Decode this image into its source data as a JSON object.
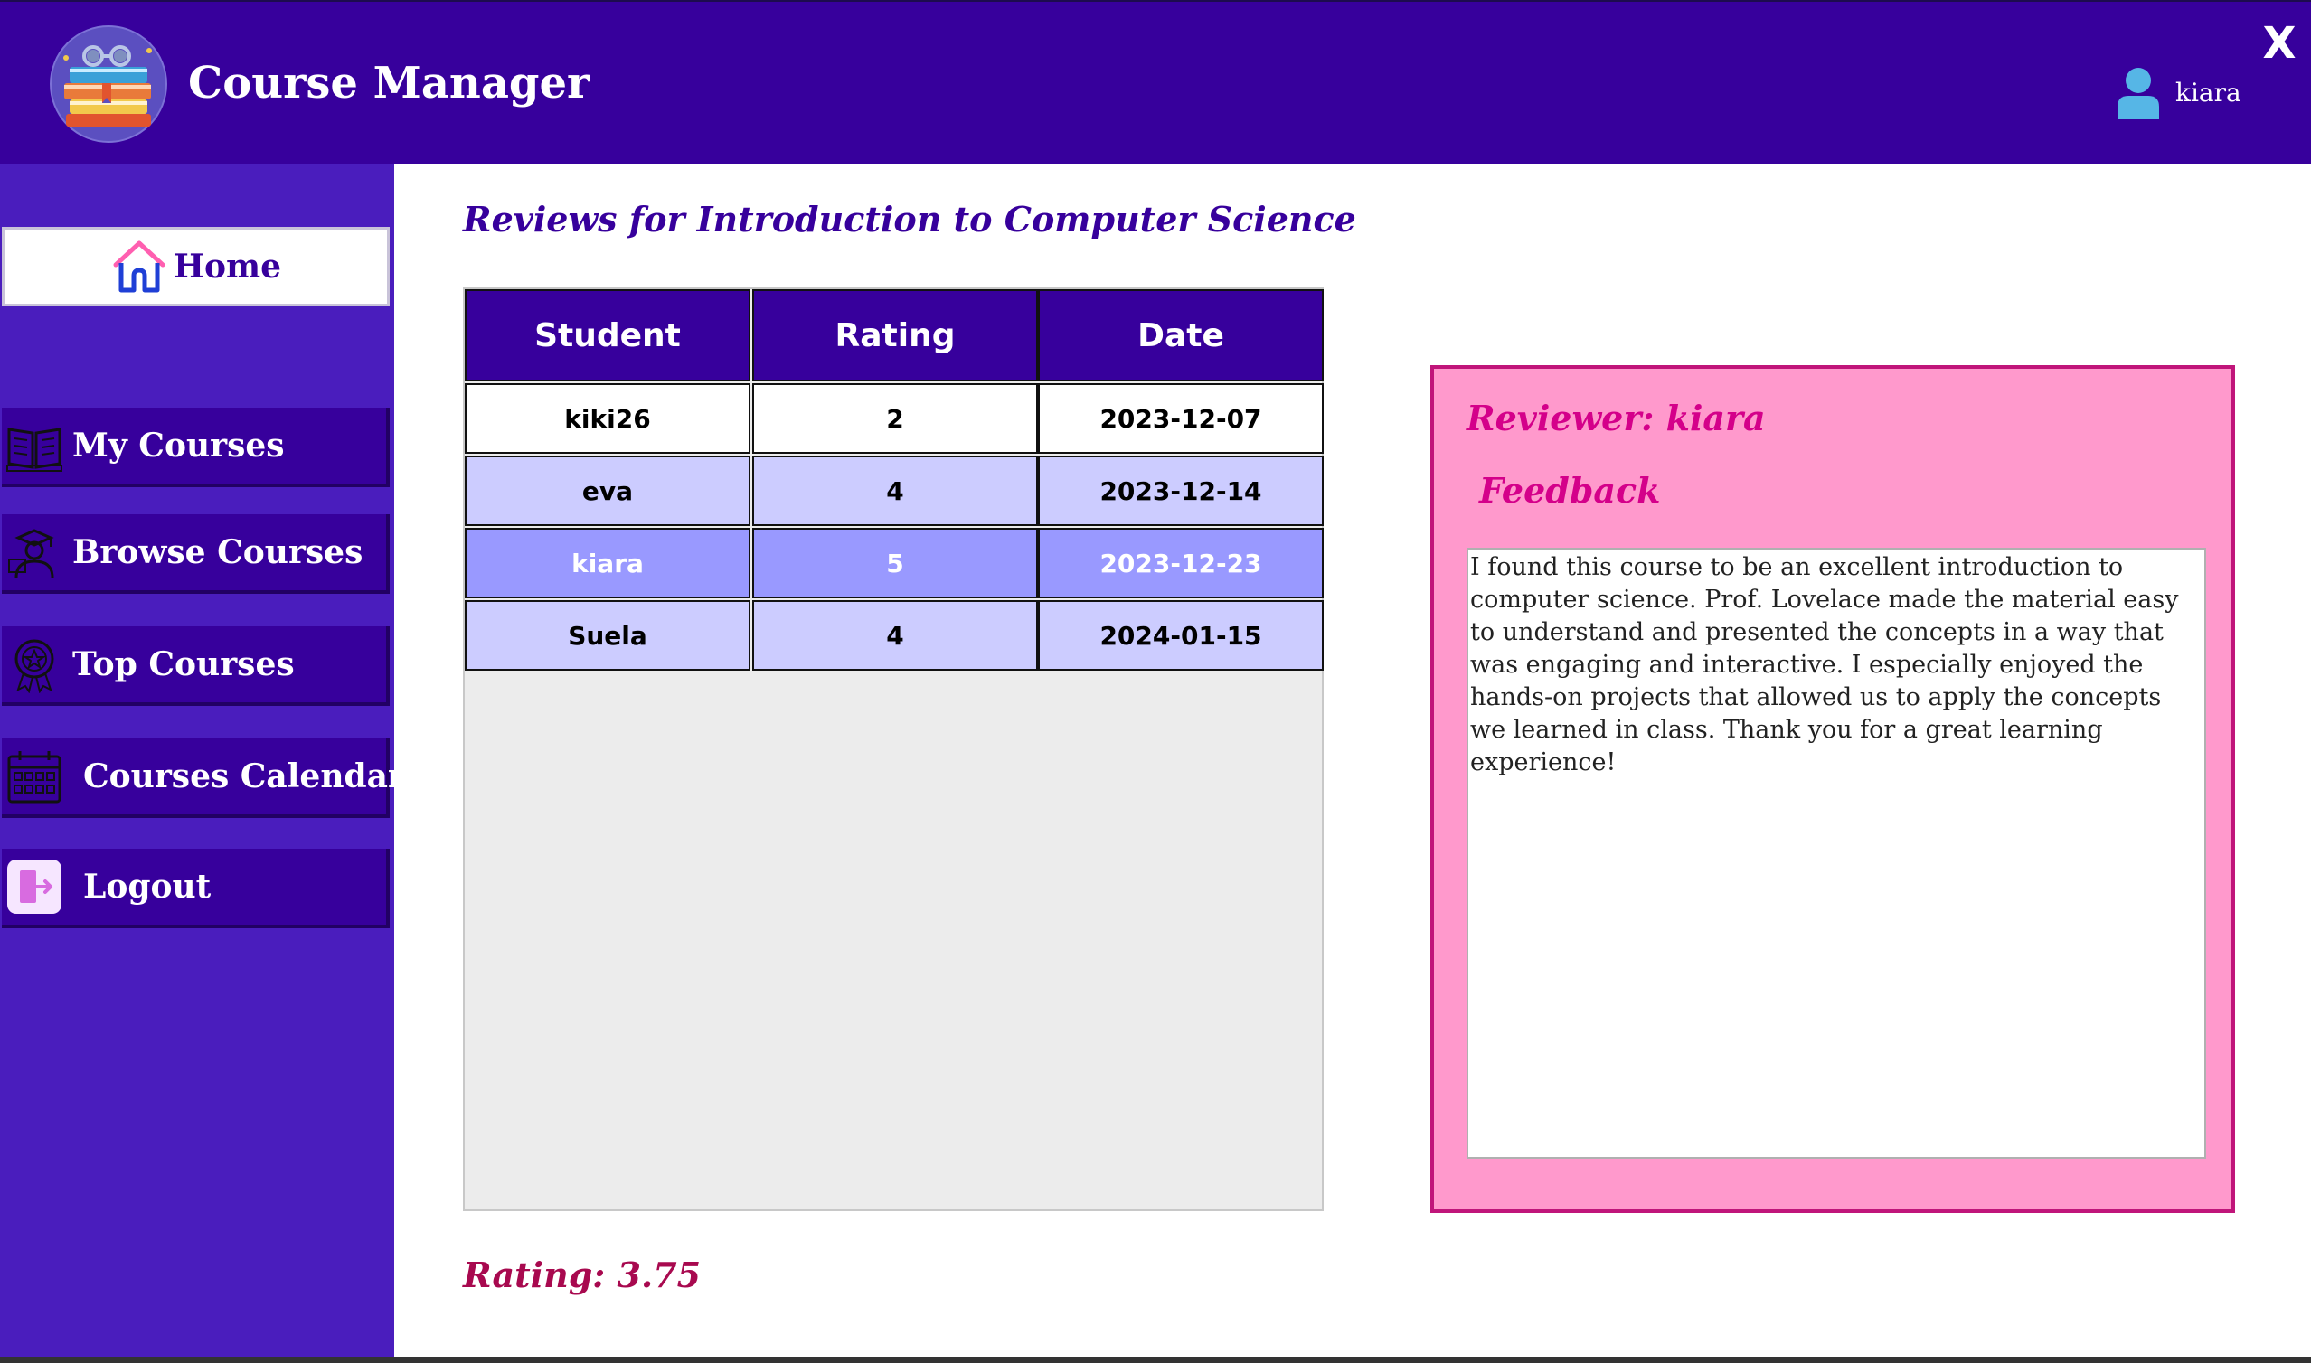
{
  "header": {
    "app_title": "Course Manager",
    "user_name": "kiara",
    "close_label": "X"
  },
  "sidebar": {
    "items": [
      {
        "label": "Home",
        "icon": "home-icon"
      },
      {
        "label": "My Courses",
        "icon": "book-icon"
      },
      {
        "label": "Browse Courses",
        "icon": "teacher-icon"
      },
      {
        "label": "Top Courses",
        "icon": "award-badge-icon"
      },
      {
        "label": "Courses Calendar",
        "icon": "calendar-icon"
      },
      {
        "label": "Logout",
        "icon": "logout-icon"
      }
    ]
  },
  "main": {
    "reviews_title": "Reviews for Introduction to Computer Science",
    "table": {
      "columns": [
        "Student",
        "Rating",
        "Date"
      ],
      "rows": [
        {
          "student": "kiki26",
          "rating": "2",
          "date": "2023-12-07",
          "state": "normal"
        },
        {
          "student": "eva",
          "rating": "4",
          "date": "2023-12-14",
          "state": "alternate"
        },
        {
          "student": "kiara",
          "rating": "5",
          "date": "2023-12-23",
          "state": "selected"
        },
        {
          "student": "Suela",
          "rating": "4",
          "date": "2024-01-15",
          "state": "alternate"
        }
      ]
    },
    "rating_summary": "Rating: 3.75"
  },
  "feedback": {
    "reviewer_label": "Reviewer: kiara",
    "feedback_label": "Feedback",
    "text": "I found this course to be an excellent introduction to computer science. Prof. Lovelace made the material easy to understand and presented the concepts in a way that was engaging and interactive. I especially enjoyed the hands-on projects that allowed us to apply the concepts we learned in class. Thank you for a great learning experience!"
  },
  "colors": {
    "header_bg": "#37009c",
    "sidebar_bg": "#4a1dbd",
    "row_normal": "#ffffff",
    "row_alternate": "#ccccff",
    "row_selected": "#9999ff",
    "feedback_bg": "#ff99cc",
    "accent_pink": "#d4008a",
    "rating_color": "#a8094f"
  }
}
